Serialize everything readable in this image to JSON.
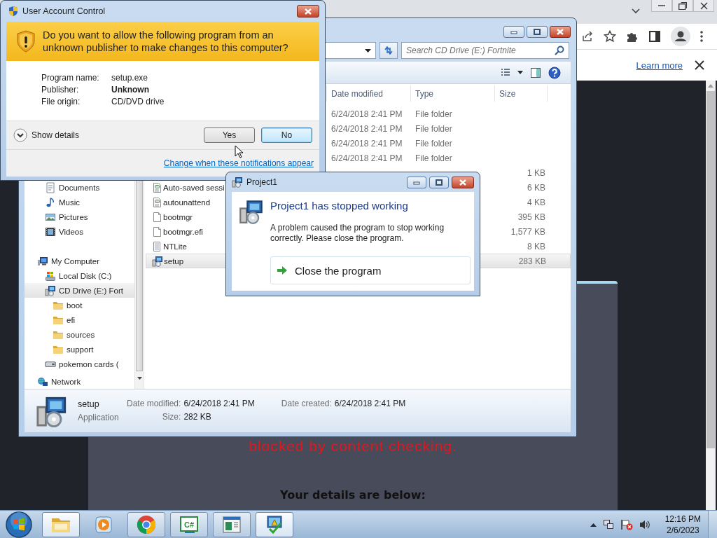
{
  "browser": {
    "info_bar": {
      "link": "Learn more"
    },
    "page": {
      "blocked_text": "blocked by content checking.",
      "details_heading": "Your details are below:"
    }
  },
  "explorer": {
    "search": {
      "placeholder": "Search CD Drive (E:) Fortnite"
    },
    "columns": [
      "Date modified",
      "Type",
      "Size"
    ],
    "nav": [
      {
        "children": [
          {
            "label": "Documents",
            "kind": "documents",
            "selected": false
          },
          {
            "label": "Music",
            "kind": "music",
            "selected": false
          },
          {
            "label": "Pictures",
            "kind": "pictures",
            "selected": false
          },
          {
            "label": "Videos",
            "kind": "videos",
            "selected": false
          }
        ]
      },
      {
        "label": "My Computer",
        "kind": "computer",
        "selected": false,
        "children": [
          {
            "label": "Local Disk (C:)",
            "kind": "disk",
            "selected": false
          },
          {
            "label": "CD Drive (E:) Fort",
            "kind": "installer",
            "selected": true,
            "children": [
              {
                "label": "boot",
                "kind": "folder",
                "selected": false
              },
              {
                "label": "efi",
                "kind": "folder",
                "selected": false
              },
              {
                "label": "sources",
                "kind": "folder",
                "selected": false
              },
              {
                "label": "support",
                "kind": "folder",
                "selected": false
              }
            ]
          },
          {
            "label": "pokemon cards (",
            "kind": "drive",
            "selected": false
          }
        ]
      },
      {
        "label": "Network",
        "kind": "network",
        "selected": false
      }
    ],
    "files": [
      {
        "date": "6/24/2018 2:41 PM",
        "type": "File folder",
        "selected": false
      },
      {
        "date": "6/24/2018 2:41 PM",
        "type": "File folder",
        "selected": false
      },
      {
        "date": "6/24/2018 2:41 PM",
        "type": "File folder",
        "selected": false
      },
      {
        "date": "6/24/2018 2:41 PM",
        "type": "File folder",
        "selected": false
      },
      {
        "size": "1 KB",
        "selected": false
      },
      {
        "kind": "settings",
        "name": "Auto-saved sessi",
        "size": "6 KB",
        "selected": false
      },
      {
        "kind": "settings",
        "name": "autounattend",
        "size": "4 KB",
        "selected": false
      },
      {
        "kind": "blank",
        "name": "bootmgr",
        "size": "395 KB",
        "selected": false
      },
      {
        "kind": "blank",
        "name": "bootmgr.efi",
        "size": "1,577 KB",
        "selected": false
      },
      {
        "kind": "text",
        "name": "NTLite",
        "size": "8 KB",
        "selected": false
      },
      {
        "kind": "installer",
        "name": "setup",
        "size": "283 KB",
        "selected": true
      }
    ],
    "details": {
      "name": "setup",
      "type": "Application",
      "fields": [
        {
          "label": "Date modified:",
          "value": "6/24/2018 2:41 PM"
        },
        {
          "label": "Size:",
          "value": "282 KB"
        },
        {
          "label": "Date created:",
          "value": "6/24/2018 2:41 PM"
        }
      ]
    }
  },
  "uac": {
    "title": "User Account Control",
    "question": "Do you want to allow the following program from an unknown publisher to make changes to this computer?",
    "fields": [
      {
        "label": "Program name:",
        "value": "setup.exe",
        "bold": false
      },
      {
        "label": "Publisher:",
        "value": "Unknown",
        "bold": true
      },
      {
        "label": "File origin:",
        "value": "CD/DVD drive",
        "bold": false
      }
    ],
    "details_toggle": "Show details",
    "buttons": [
      {
        "label": "Yes",
        "focused": false
      },
      {
        "label": "No",
        "focused": true
      }
    ],
    "link": "Change when these notifications appear"
  },
  "error_dialog": {
    "title": "Project1",
    "heading": "Project1 has stopped working",
    "message": "A problem caused the program to stop working correctly. Please close the program.",
    "command": "Close the program"
  },
  "taskbar": {
    "items": [
      {
        "kind": "explorer",
        "running": true,
        "active": true
      },
      {
        "kind": "media",
        "running": false,
        "active": false
      },
      {
        "kind": "browser",
        "running": true,
        "active": false
      },
      {
        "kind": "code",
        "label": "C#",
        "running": true,
        "active": false
      },
      {
        "kind": "window",
        "running": true,
        "active": false
      },
      {
        "kind": "installer",
        "running": true,
        "active": true
      }
    ],
    "clock": {
      "time": "12:16 PM",
      "date": "2/6/2023"
    }
  }
}
